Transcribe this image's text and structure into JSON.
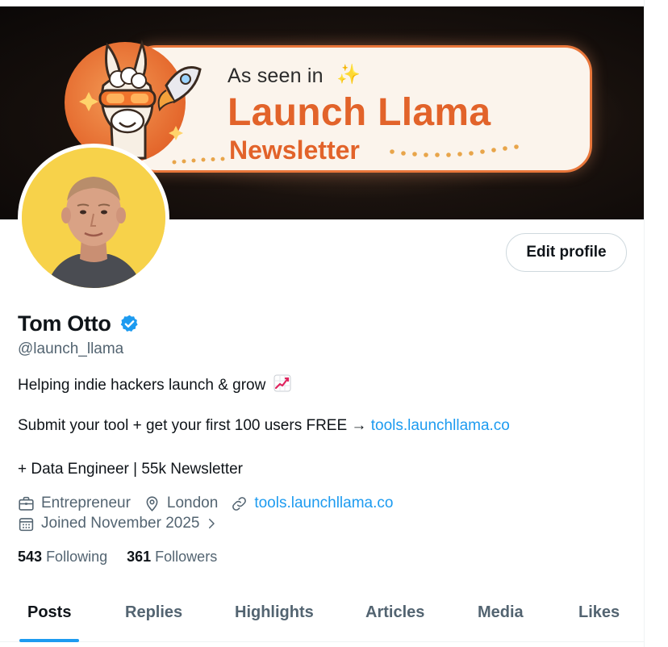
{
  "banner": {
    "kicker": "As seen in",
    "title": "Launch Llama",
    "subtitle": "Newsletter",
    "accent_color": "#e2632a"
  },
  "profile": {
    "edit_label": "Edit profile",
    "name": "Tom Otto",
    "handle": "@launch_llama",
    "verified_color": "#1d9bf0"
  },
  "bio": {
    "line1": "Helping indie hackers launch & grow",
    "line1_emoji": "chart-increasing-icon",
    "line2_text": "Submit your tool + get your first 100 users FREE → ",
    "line2_link": "tools.launchllama.co",
    "line3": "+ Data Engineer | 55k Newsletter"
  },
  "meta": {
    "category": "Entrepreneur",
    "location": "London",
    "website": "tools.launchllama.co",
    "joined": "Joined November 2025"
  },
  "stats": {
    "following_count": "543",
    "following_label": "Following",
    "followers_count": "361",
    "followers_label": "Followers"
  },
  "tabs": [
    {
      "label": "Posts",
      "active": true
    },
    {
      "label": "Replies"
    },
    {
      "label": "Highlights"
    },
    {
      "label": "Articles"
    },
    {
      "label": "Media"
    },
    {
      "label": "Likes"
    }
  ],
  "colors": {
    "link": "#1d9bf0",
    "secondary_text": "#536471",
    "avatar_bg": "#f7d24a"
  }
}
